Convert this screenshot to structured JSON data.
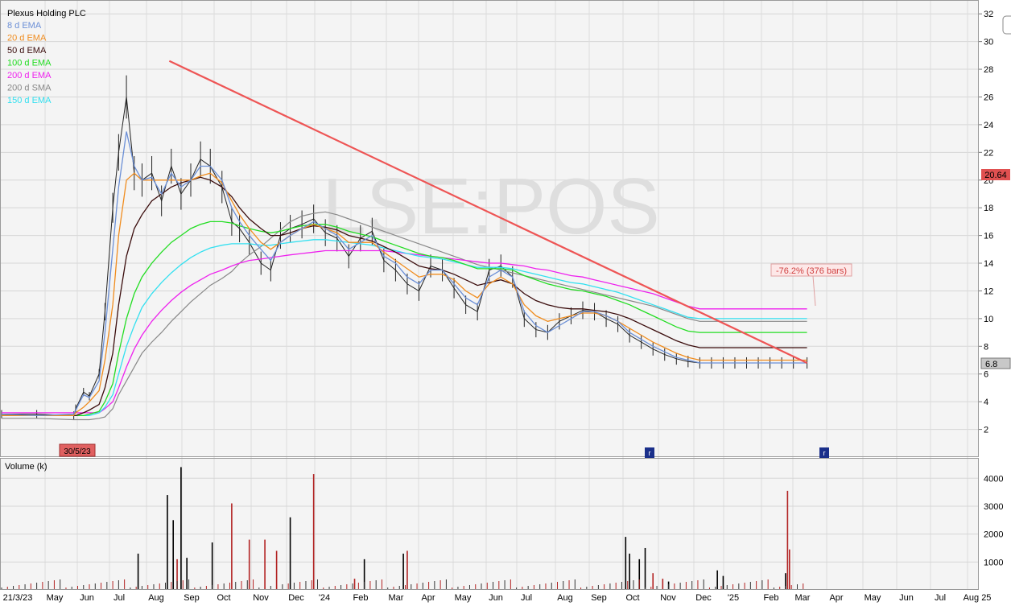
{
  "chart": {
    "title": "Plexus Holding PLC",
    "watermark": "LSE:POS",
    "last_price_label": "20.64",
    "current_price_label": "6.8",
    "start_marker": "30/5/23",
    "event_marker": "r",
    "annotation": "-76.2% (376 bars)",
    "volume_label": "Volume (k)"
  },
  "legend": [
    {
      "label": "8 d EMA",
      "color": "#6b8fd6"
    },
    {
      "label": "20 d EMA",
      "color": "#f08c1e"
    },
    {
      "label": "50 d EMA",
      "color": "#3a0c0c"
    },
    {
      "label": "100 d EMA",
      "color": "#22dd22"
    },
    {
      "label": "200 d EMA",
      "color": "#ee22ee"
    },
    {
      "label": "200 d SMA",
      "color": "#888888"
    },
    {
      "label": "150 d EMA",
      "color": "#33e0f0"
    }
  ],
  "chart_data": [
    {
      "type": "line",
      "title": "Plexus Holding PLC",
      "ylim": [
        0,
        33
      ],
      "price_axis_ticks": [
        2,
        4,
        6,
        8,
        10,
        12,
        14,
        16,
        18,
        20,
        22,
        24,
        26,
        28,
        30,
        32
      ],
      "x_tick_labels": [
        "21/3/23",
        "May",
        "Jun",
        "Jul",
        "Aug",
        "Sep",
        "Oct",
        "Nov",
        "Dec",
        "'24",
        "Feb",
        "Mar",
        "Apr",
        "May",
        "Jun",
        "Jul",
        "Aug",
        "Sep",
        "Oct",
        "Nov",
        "Dec",
        "'25",
        "Feb",
        "Mar",
        "Apr",
        "May",
        "Jun",
        "Jul",
        "Aug 25"
      ],
      "grid": true,
      "legend_placement": "top-left",
      "price_axis": "right",
      "x_idx": [
        0,
        18,
        37,
        38,
        42,
        45,
        50,
        53,
        57,
        60,
        64,
        68,
        72,
        77,
        82,
        87,
        92,
        97,
        102,
        107,
        113,
        118,
        122,
        127,
        133,
        138,
        143,
        148,
        154,
        160,
        166,
        172,
        178,
        184,
        190,
        196,
        202,
        208,
        214,
        220,
        226,
        232,
        238,
        244,
        250,
        256,
        262,
        268,
        274,
        280,
        286,
        292,
        298,
        304,
        310,
        316,
        322,
        328,
        334,
        340,
        346,
        352,
        358,
        364,
        370,
        376,
        382,
        388,
        394,
        400,
        406,
        413
      ],
      "series": [
        {
          "name": "8 d EMA",
          "values": [
            3.1,
            3.0,
            3.1,
            3.4,
            4.5,
            4.3,
            5.5,
            9.0,
            15.0,
            19.5,
            23.5,
            21.0,
            20.0,
            20.2,
            19.0,
            20.5,
            19.5,
            20.0,
            21.0,
            21.0,
            20.0,
            18.0,
            17.0,
            16.0,
            15.0,
            14.2,
            15.5,
            16.0,
            16.5,
            17.0,
            16.5,
            16.0,
            15.0,
            15.5,
            16.0,
            14.5,
            14.0,
            13.0,
            12.5,
            13.5,
            13.5,
            12.5,
            11.5,
            11.0,
            13.0,
            13.5,
            13.0,
            10.5,
            9.5,
            9.0,
            9.5,
            10.0,
            10.5,
            10.5,
            10.2,
            9.8,
            9.0,
            8.5,
            8.0,
            7.6,
            7.2,
            7.0,
            6.8,
            6.8,
            6.8,
            6.8,
            6.8,
            6.8,
            6.8,
            6.8,
            6.8,
            6.8
          ]
        },
        {
          "name": "20 d EMA",
          "values": [
            3.0,
            3.0,
            3.0,
            3.2,
            3.6,
            4.0,
            4.8,
            7.0,
            11.0,
            16.0,
            20.0,
            20.5,
            20.0,
            20.0,
            20.0,
            20.0,
            20.0,
            20.0,
            20.3,
            20.5,
            19.8,
            18.5,
            17.5,
            16.5,
            15.5,
            15.0,
            15.5,
            16.0,
            16.5,
            16.8,
            16.5,
            16.2,
            15.5,
            15.5,
            15.5,
            14.8,
            14.2,
            13.6,
            13.0,
            13.2,
            13.2,
            12.8,
            12.0,
            11.5,
            12.5,
            13.0,
            12.5,
            11.0,
            10.2,
            9.8,
            10.0,
            10.2,
            10.4,
            10.4,
            10.2,
            9.8,
            9.3,
            8.8,
            8.3,
            7.9,
            7.5,
            7.2,
            7.0,
            7.0,
            7.0,
            7.0,
            7.0,
            7.0,
            7.0,
            7.0,
            7.0,
            7.0
          ]
        },
        {
          "name": "50 d EMA",
          "values": [
            3.0,
            3.0,
            3.0,
            3.0,
            3.2,
            3.4,
            3.8,
            5.0,
            7.5,
            11.0,
            14.5,
            16.5,
            17.5,
            18.5,
            19.0,
            19.5,
            19.8,
            20.0,
            20.2,
            20.0,
            19.5,
            18.8,
            18.0,
            17.2,
            16.5,
            16.0,
            16.0,
            16.2,
            16.5,
            16.7,
            16.6,
            16.4,
            16.0,
            15.8,
            15.6,
            15.2,
            14.8,
            14.3,
            13.8,
            13.6,
            13.5,
            13.2,
            12.8,
            12.4,
            12.6,
            12.8,
            12.5,
            11.8,
            11.3,
            11.0,
            10.8,
            10.7,
            10.7,
            10.6,
            10.5,
            10.3,
            10.0,
            9.6,
            9.2,
            8.8,
            8.4,
            8.1,
            7.9,
            7.9,
            7.9,
            7.9,
            7.9,
            7.9,
            7.9,
            7.9,
            7.9,
            7.9
          ]
        },
        {
          "name": "100 d EMA",
          "values": [
            3.0,
            3.0,
            3.0,
            3.0,
            3.0,
            3.1,
            3.3,
            4.0,
            5.3,
            7.5,
            10.0,
            11.8,
            13.0,
            14.0,
            14.8,
            15.5,
            16.0,
            16.5,
            16.8,
            17.0,
            17.0,
            16.9,
            16.7,
            16.5,
            16.3,
            16.2,
            16.3,
            16.5,
            16.7,
            16.8,
            16.8,
            16.6,
            16.3,
            16.1,
            15.9,
            15.6,
            15.3,
            15.0,
            14.7,
            14.5,
            14.4,
            14.2,
            13.9,
            13.6,
            13.6,
            13.6,
            13.5,
            13.1,
            12.8,
            12.5,
            12.3,
            12.1,
            12.0,
            11.8,
            11.6,
            11.3,
            11.0,
            10.6,
            10.2,
            9.8,
            9.4,
            9.1,
            9.0,
            9.0,
            9.0,
            9.0,
            9.0,
            9.0,
            9.0,
            9.0,
            9.0,
            9.0
          ]
        },
        {
          "name": "150 d EMA",
          "values": [
            3.0,
            3.0,
            3.0,
            3.0,
            3.0,
            3.0,
            3.2,
            3.6,
            4.5,
            6.0,
            8.0,
            9.5,
            10.8,
            11.8,
            12.6,
            13.3,
            13.9,
            14.4,
            14.8,
            15.1,
            15.3,
            15.4,
            15.4,
            15.4,
            15.3,
            15.3,
            15.4,
            15.5,
            15.6,
            15.7,
            15.7,
            15.6,
            15.5,
            15.4,
            15.3,
            15.1,
            14.9,
            14.7,
            14.5,
            14.4,
            14.3,
            14.1,
            13.9,
            13.7,
            13.7,
            13.7,
            13.6,
            13.4,
            13.2,
            13.0,
            12.8,
            12.6,
            12.5,
            12.3,
            12.1,
            11.9,
            11.6,
            11.3,
            11.0,
            10.7,
            10.4,
            10.1,
            10.0,
            10.0,
            10.0,
            10.0,
            10.0,
            10.0,
            10.0,
            10.0,
            10.0,
            10.0
          ]
        },
        {
          "name": "200 d EMA",
          "values": [
            3.2,
            3.2,
            3.2,
            3.2,
            3.2,
            3.2,
            3.2,
            3.5,
            4.0,
            5.0,
            6.5,
            7.8,
            8.8,
            9.8,
            10.6,
            11.3,
            11.9,
            12.4,
            12.8,
            13.2,
            13.5,
            13.8,
            14.0,
            14.2,
            14.3,
            14.4,
            14.5,
            14.6,
            14.7,
            14.8,
            14.9,
            14.9,
            14.9,
            14.9,
            14.9,
            14.9,
            14.8,
            14.7,
            14.6,
            14.5,
            14.4,
            14.3,
            14.2,
            14.1,
            14.0,
            14.0,
            13.9,
            13.8,
            13.6,
            13.5,
            13.3,
            13.1,
            13.0,
            12.8,
            12.6,
            12.4,
            12.2,
            12.0,
            11.8,
            11.5,
            11.2,
            10.9,
            10.7,
            10.7,
            10.7,
            10.7,
            10.7,
            10.7,
            10.7,
            10.7,
            10.7,
            10.7
          ]
        },
        {
          "name": "200 d SMA",
          "values": [
            2.8,
            2.8,
            2.7,
            2.7,
            2.7,
            2.7,
            2.8,
            2.9,
            3.5,
            4.5,
            5.5,
            6.5,
            7.5,
            8.3,
            9.0,
            9.8,
            10.5,
            11.2,
            11.8,
            12.4,
            12.9,
            13.4,
            14.0,
            14.6,
            15.2,
            15.8,
            16.4,
            17.0,
            17.4,
            17.6,
            17.7,
            17.5,
            17.2,
            16.9,
            16.6,
            16.3,
            16.0,
            15.7,
            15.4,
            15.1,
            14.8,
            14.5,
            14.2,
            13.9,
            13.7,
            13.5,
            13.3,
            13.1,
            12.9,
            12.7,
            12.5,
            12.3,
            12.1,
            11.9,
            11.7,
            11.5,
            11.3,
            11.1,
            10.9,
            10.6,
            10.3,
            10.0,
            9.8,
            9.8,
            9.8,
            9.8,
            9.8,
            9.8,
            9.8,
            9.8,
            9.8,
            9.8
          ]
        },
        {
          "name": "Plexus Holding PLC",
          "values": [
            3.1,
            3.1,
            3.0,
            3.5,
            4.7,
            4.4,
            6.0,
            10.5,
            18.0,
            22.0,
            26.0,
            20.5,
            20.0,
            20.5,
            18.5,
            21.0,
            19.0,
            20.0,
            21.5,
            21.0,
            19.5,
            17.0,
            16.5,
            15.5,
            14.0,
            13.5,
            16.0,
            16.5,
            16.8,
            17.2,
            16.2,
            15.8,
            14.5,
            15.8,
            16.3,
            14.2,
            13.5,
            12.5,
            12.0,
            13.8,
            13.5,
            12.2,
            11.0,
            10.5,
            13.5,
            13.8,
            13.0,
            10.0,
            9.2,
            9.0,
            9.8,
            10.2,
            10.6,
            10.5,
            10.0,
            9.6,
            8.8,
            8.3,
            7.8,
            7.4,
            7.1,
            6.9,
            6.8,
            6.8,
            6.8,
            6.8,
            6.8,
            6.8,
            6.8,
            6.8,
            6.8,
            6.8
          ]
        }
      ],
      "trendline": {
        "from": {
          "x_idx": 86,
          "y": 28.6
        },
        "to": {
          "x_idx": 413,
          "y": 6.8
        },
        "label": "-76.2% (376 bars)"
      }
    },
    {
      "type": "bar",
      "title": "Volume (k)",
      "ylim": [
        0,
        4700
      ],
      "y_ticks": [
        1000,
        2000,
        3000,
        4000
      ],
      "x_idx": [
        70,
        85,
        88,
        90,
        92,
        95,
        108,
        118,
        127,
        135,
        141,
        148,
        160,
        181,
        186,
        206,
        208,
        320,
        322,
        327,
        330,
        334,
        339,
        342,
        367,
        370,
        402,
        403,
        404
      ],
      "values": [
        1300,
        3400,
        2500,
        1100,
        4400,
        1150,
        1700,
        3100,
        1800,
        1800,
        1400,
        2600,
        4150,
        400,
        1100,
        1300,
        1400,
        1900,
        1300,
        1100,
        1500,
        600,
        400,
        300,
        700,
        500,
        600,
        3550,
        1450
      ],
      "colors": [
        "#000000",
        "#000000",
        "#000000",
        "#b22222",
        "#000000",
        "#000000",
        "#000000",
        "#b22222",
        "#b22222",
        "#b22222",
        "#b22222",
        "#000000",
        "#b22222",
        "#b22222",
        "#000000",
        "#000000",
        "#b22222",
        "#000000",
        "#000000",
        "#000000",
        "#000000",
        "#b22222",
        "#b22222",
        "#000000",
        "#000000",
        "#000000",
        "#000000",
        "#b22222",
        "#b22222"
      ]
    }
  ]
}
